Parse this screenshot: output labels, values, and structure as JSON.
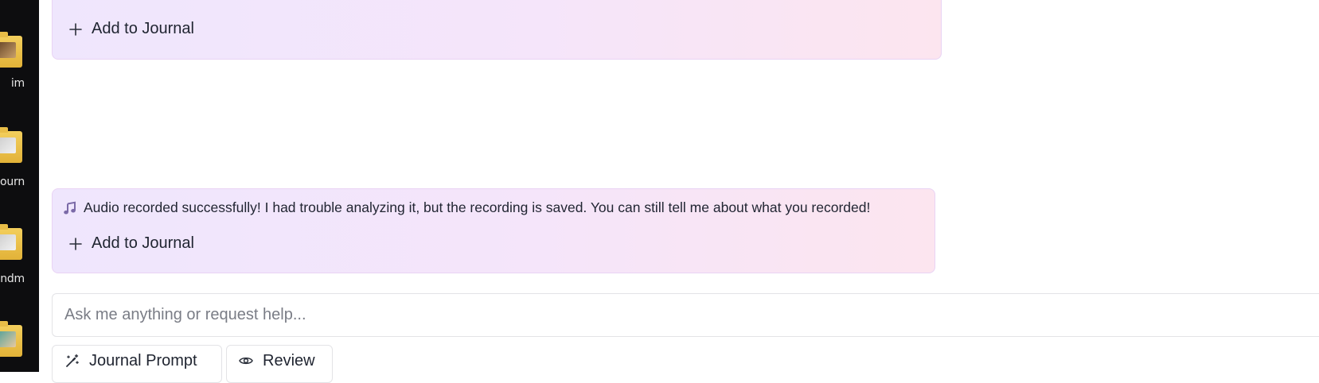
{
  "desktop": {
    "icons": [
      {
        "label": "im",
        "icon": "folder-icon"
      },
      {
        "label": "ourn",
        "icon": "folder-icon"
      },
      {
        "label": "ndm",
        "icon": "folder-icon"
      },
      {
        "label": "",
        "icon": "folder-icon"
      }
    ]
  },
  "chat": {
    "messages": [
      {
        "text": "",
        "action_label": "Add to Journal"
      },
      {
        "icon": "music-note-icon",
        "text": "Audio recorded successfully! I had trouble analyzing it, but the recording is saved. You can still tell me about what you recorded!",
        "action_label": "Add to Journal"
      }
    ]
  },
  "composer": {
    "placeholder": "Ask me anything or request help...",
    "value": "",
    "buttons": [
      {
        "label": "Journal Prompt",
        "icon": "magic-wand-icon"
      },
      {
        "label": "Review",
        "icon": "eye-icon"
      }
    ]
  },
  "colors": {
    "bubble_gradient_start": "#efe6fd",
    "bubble_gradient_end": "#fce5ef",
    "accent_icon": "#7b6aa8"
  }
}
